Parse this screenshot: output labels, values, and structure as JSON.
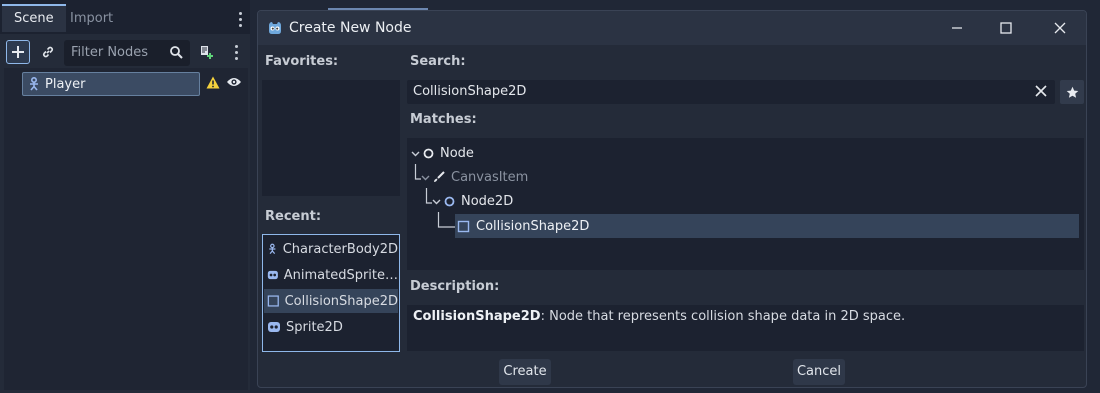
{
  "dock": {
    "tabs": [
      {
        "label": "Scene",
        "active": true
      },
      {
        "label": "Import",
        "active": false
      }
    ],
    "filter_placeholder": "Filter Nodes",
    "tree": [
      {
        "label": "Player",
        "selected": true,
        "icon": "character-body-icon",
        "warning": true,
        "visible": true
      }
    ]
  },
  "dialog": {
    "title": "Create New Node",
    "favorites_label": "Favorites:",
    "recent_label": "Recent:",
    "recent_items": [
      {
        "label": "CharacterBody2D",
        "icon": "character-body-icon",
        "selected": false
      },
      {
        "label": "AnimatedSprite…",
        "icon": "animated-sprite-icon",
        "selected": false
      },
      {
        "label": "CollisionShape2D",
        "icon": "collision-shape-icon",
        "selected": true
      },
      {
        "label": "Sprite2D",
        "icon": "sprite-icon",
        "selected": false
      }
    ],
    "search_label": "Search:",
    "search_value": "CollisionShape2D",
    "matches_label": "Matches:",
    "matches": [
      {
        "label": "Node",
        "icon": "node-circle-icon",
        "depth": 0,
        "expanded": true,
        "dimmed": false
      },
      {
        "label": "CanvasItem",
        "icon": "brush-icon",
        "depth": 1,
        "expanded": true,
        "dimmed": true
      },
      {
        "label": "Node2D",
        "icon": "node2d-circle-icon",
        "depth": 2,
        "expanded": true,
        "dimmed": false
      },
      {
        "label": "CollisionShape2D",
        "icon": "collision-shape-icon",
        "depth": 3,
        "selected": true,
        "dimmed": false
      }
    ],
    "description_label": "Description:",
    "description_name": "CollisionShape2D",
    "description_text": ": Node that represents collision shape data in 2D space.",
    "create_label": "Create",
    "cancel_label": "Cancel"
  },
  "colors": {
    "accent": "#8fb8ea",
    "warning": "#f4d13d",
    "node2d_blue": "#9ab8ef",
    "character_blue": "#9ab8ef"
  }
}
